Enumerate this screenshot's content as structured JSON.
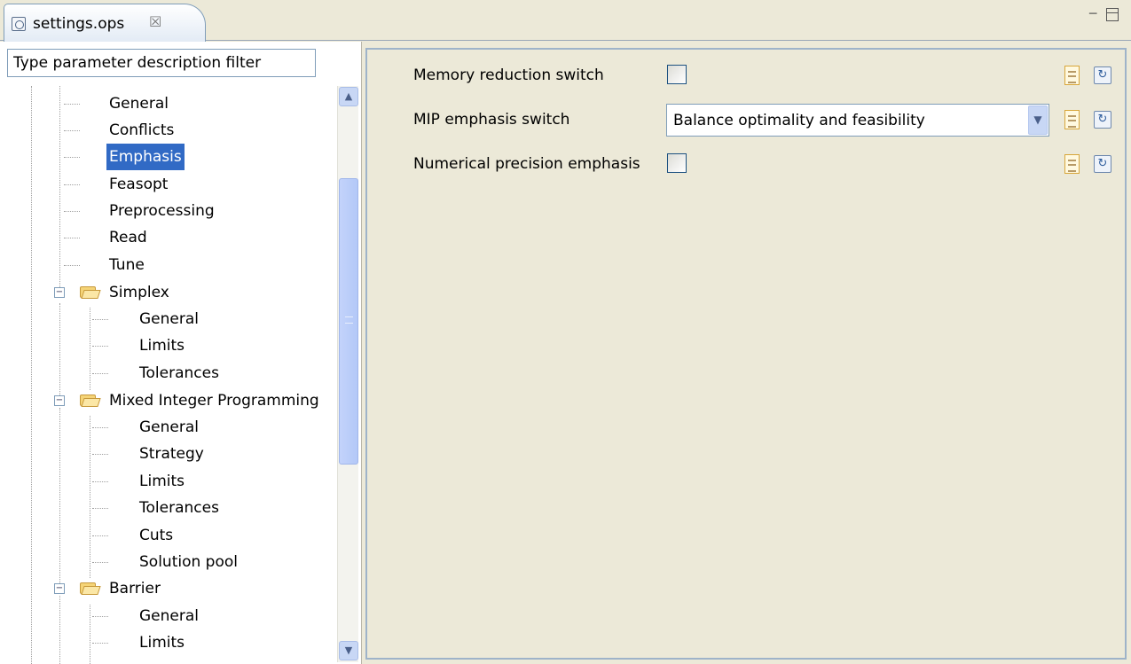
{
  "tab": {
    "title": "settings.ops",
    "close": "☒"
  },
  "window_controls": {
    "minimize": "─"
  },
  "filter": {
    "placeholder": "Type parameter description filter",
    "value": "Type parameter description filter"
  },
  "tree": {
    "selected": "Emphasis",
    "top_items": [
      "General",
      "Conflicts",
      "Emphasis",
      "Feasopt",
      "Preprocessing",
      "Read",
      "Tune"
    ],
    "simplex": {
      "label": "Simplex",
      "children": [
        "General",
        "Limits",
        "Tolerances"
      ]
    },
    "mip": {
      "label": "Mixed Integer Programming",
      "children": [
        "General",
        "Strategy",
        "Limits",
        "Tolerances",
        "Cuts",
        "Solution pool"
      ]
    },
    "barrier": {
      "label": "Barrier",
      "children": [
        "General",
        "Limits"
      ]
    },
    "toggle_symbol": "−",
    "scroll_up": "▲",
    "scroll_down": "▼"
  },
  "parameters": {
    "memory_reduction": {
      "label": "Memory reduction switch",
      "checked": false
    },
    "mip_emphasis": {
      "label": "MIP emphasis switch",
      "value": "Balance optimality and feasibility"
    },
    "numerical_precision": {
      "label": "Numerical precision emphasis",
      "checked": false
    },
    "combo_arrow": "▼",
    "reset_glyph": "↻"
  },
  "colors": {
    "selection": "#316ac5",
    "panel_bg": "#ece9d8",
    "scroll_accent": "#c8d7f5"
  },
  "icons": [
    "file-settings-icon",
    "close-icon",
    "minimize-icon",
    "maximize-icon",
    "folder-icon",
    "doc-help-icon",
    "reset-default-icon",
    "chevron-down-icon"
  ]
}
